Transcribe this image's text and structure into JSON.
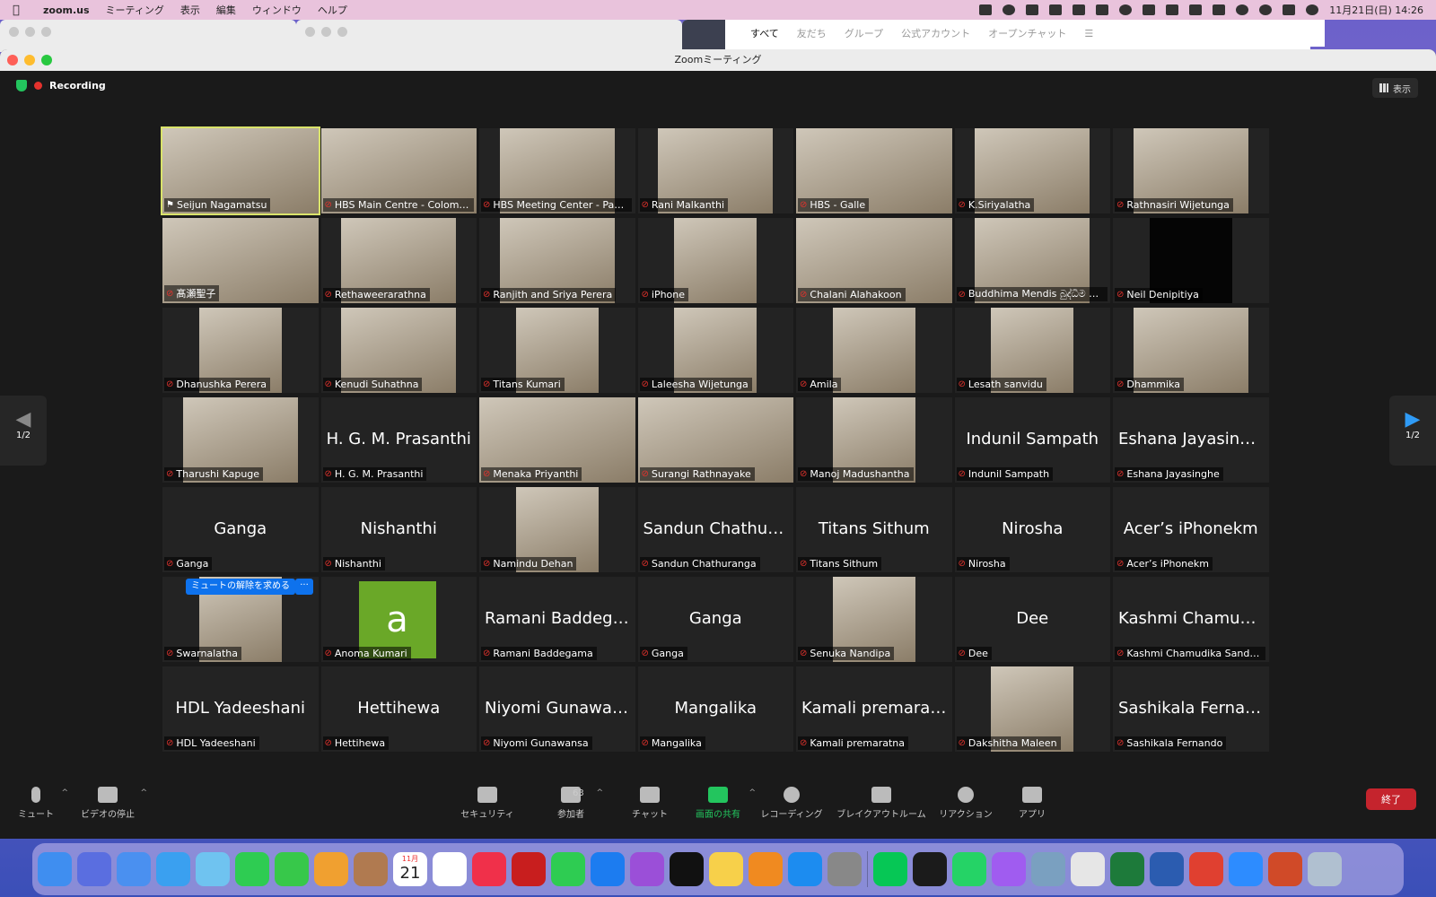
{
  "menubar": {
    "app": "zoom.us",
    "items": [
      "ミーティング",
      "表示",
      "編集",
      "ウィンドウ",
      "ヘルプ"
    ],
    "clock": "11月21日(日)  14:26"
  },
  "line_window": {
    "tabs": [
      "すべて",
      "友だち",
      "グループ",
      "公式アカウント",
      "オープンチャット"
    ]
  },
  "zoom": {
    "title": "Zoomミーティング",
    "recording_label": "Recording",
    "view_label": "表示",
    "page_indicator_left": "1/2",
    "page_indicator_right": "1/2",
    "unmute_request": "ミュートの解除を求める",
    "more_button": "···",
    "tiles": [
      {
        "name": "Seijun Nagamatsu",
        "video": true,
        "active": true,
        "pinned": true
      },
      {
        "name": "HBS Main Centre - Colombo",
        "video": true
      },
      {
        "name": "HBS Meeting Center - Padu...",
        "video": true
      },
      {
        "name": "Rani Malkanthi",
        "video": true
      },
      {
        "name": "HBS - Galle",
        "video": true
      },
      {
        "name": "K.Siriyalatha",
        "video": true
      },
      {
        "name": "Rathnasiri Wijetunga",
        "video": true
      },
      {
        "name": "髙瀬聖子",
        "video": true
      },
      {
        "name": "Rethaweerarathna",
        "video": true
      },
      {
        "name": "Ranjith and Sriya Perera",
        "video": true
      },
      {
        "name": "iPhone",
        "video": true
      },
      {
        "name": "Chalani Alahakoon",
        "video": true
      },
      {
        "name": "Buddhima Mendis බුද්ධිම මෙ...",
        "video": true
      },
      {
        "name": "Neil  Denipitiya",
        "video": true,
        "dark": true
      },
      {
        "name": "Dhanushka Perera",
        "video": true
      },
      {
        "name": "Kenudi Suhathna",
        "video": true
      },
      {
        "name": "Titans Kumari",
        "video": true
      },
      {
        "name": "Laleesha Wijetunga",
        "video": true
      },
      {
        "name": "Amila",
        "video": true
      },
      {
        "name": "Lesath sanvidu",
        "video": true
      },
      {
        "name": "Dhammika",
        "video": true
      },
      {
        "name": "Tharushi Kapuge",
        "video": true
      },
      {
        "name": "H. G. M. Prasanthi",
        "big": "H. G. M. Prasanthi"
      },
      {
        "name": "Menaka Priyanthi",
        "video": true
      },
      {
        "name": "Surangi Rathnayake",
        "video": true
      },
      {
        "name": "Manoj Madushantha",
        "video": true
      },
      {
        "name": "Indunil Sampath",
        "big": "Indunil Sampath"
      },
      {
        "name": "Eshana Jayasinghe",
        "big": "Eshana Jayasinghe"
      },
      {
        "name": "Ganga",
        "big": "Ganga"
      },
      {
        "name": "Nishanthi",
        "big": "Nishanthi"
      },
      {
        "name": "Namindu Dehan",
        "video": true
      },
      {
        "name": "Sandun Chathuranga",
        "big": "Sandun Chathura..."
      },
      {
        "name": "Titans Sithum",
        "big": "Titans Sithum"
      },
      {
        "name": "Nirosha",
        "big": "Nirosha"
      },
      {
        "name": "Acer’s iPhonekm",
        "big": "Acer’s iPhonekm"
      },
      {
        "name": "Swarnalatha",
        "video": true,
        "unmute": true
      },
      {
        "name": "Anoma Kumari",
        "letter": "a"
      },
      {
        "name": "Ramani Baddegama",
        "big": "Ramani Baddega..."
      },
      {
        "name": "Ganga",
        "big": "Ganga"
      },
      {
        "name": "Senuka Nandipa",
        "video": true
      },
      {
        "name": "Dee",
        "big": "Dee"
      },
      {
        "name": "Kashmi Chamudika Sandan...",
        "big": "Kashmi Chamudik..."
      },
      {
        "name": "HDL Yadeeshani",
        "big": "HDL Yadeeshani"
      },
      {
        "name": "Hettihewa",
        "big": "Hettihewa"
      },
      {
        "name": "Niyomi Gunawansa",
        "big": "Niyomi Gunawansa"
      },
      {
        "name": "Mangalika",
        "big": "Mangalika"
      },
      {
        "name": "Kamali premaratna",
        "big": "Kamali premaratna"
      },
      {
        "name": "Dakshitha Maleen",
        "video": true
      },
      {
        "name": "Sashikala Fernando",
        "big": "Sashikala Fernando"
      }
    ]
  },
  "toolbar": {
    "mute": "ミュート",
    "stop_video": "ビデオの停止",
    "security": "セキュリティ",
    "participants": "参加者",
    "participants_count": "63",
    "chat": "チャット",
    "share_screen": "画面の共有",
    "recording": "レコーディング",
    "breakout": "ブレイクアウトルーム",
    "reactions": "リアクション",
    "apps": "アプリ",
    "end": "終了"
  },
  "dock": {
    "calendar_month": "11月",
    "calendar_day": "21",
    "colors": [
      "#3f8ef0",
      "#5a6ee0",
      "#4a90f0",
      "#3aa0f0",
      "#6fc3f0",
      "#2ecc52",
      "#37c84a",
      "#f0a030",
      "#b07a50",
      "#ffffff",
      "#ffffff",
      "#f0304a",
      "#c81e1e",
      "#2ecc52",
      "#1c7cf0",
      "#9b4fd8",
      "#111111",
      "#f7d04a",
      "#f08a20",
      "#1c8cf0",
      "#888888",
      "#06c755",
      "#1b1b1b",
      "#25d366",
      "#a05cf0",
      "#7aa0c0",
      "#e6e6e6",
      "#1d7a3a",
      "#2b5cb0",
      "#e04030",
      "#2d8cff",
      "#d04a28",
      "#b0c0d0"
    ]
  }
}
